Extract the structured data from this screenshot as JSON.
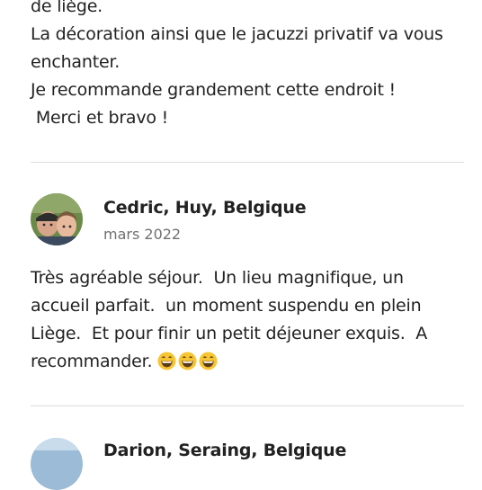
{
  "reviews": [
    {
      "text_lines": [
        "de liège.",
        "La décoration ainsi que le jacuzzi privatif va vous",
        "enchanter.",
        "Je recommande grandement cette endroit !",
        " Merci et bravo !"
      ]
    },
    {
      "reviewer": "Cedric, Huy, Belgique",
      "date": "mars 2022",
      "avatar_icon": "reviewer-photo-avatar",
      "text_lines": [
        "Très agréable séjour.  Un lieu magnifique, un",
        "accueil parfait.  un moment suspendu en plein",
        "Liège.  Et pour finir un petit déjeuner exquis.  A",
        "recommander."
      ],
      "emojis": [
        "grinning-face-emoji",
        "grinning-face-emoji",
        "grinning-face-emoji"
      ]
    },
    {
      "reviewer": "Darion, Seraing, Belgique",
      "avatar_icon": "reviewer-photo-avatar"
    }
  ],
  "colors": {
    "text": "#222222",
    "muted": "#717171",
    "divider": "#dddddd",
    "emoji_face": "#f7c531"
  }
}
